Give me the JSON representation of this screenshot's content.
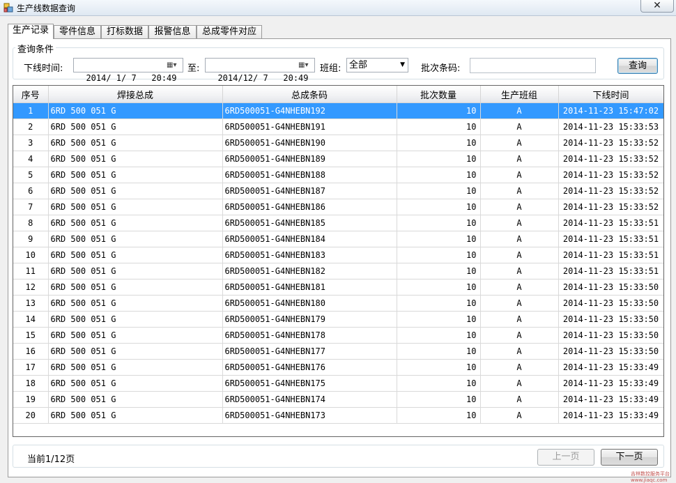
{
  "window": {
    "title": "生产线数据查询",
    "close_glyph": "✕"
  },
  "tabs": [
    "生产记录",
    "零件信息",
    "打标数据",
    "报警信息",
    "总成零件对应"
  ],
  "query": {
    "group_title": "查询条件",
    "time_label": "下线时间:",
    "start_time": "2014/ 1/ 7   20:49",
    "to_label": "至:",
    "end_time": "2014/12/ 7   20:49",
    "shift_label": "班组:",
    "shift_value": "全部",
    "batch_label": "批次条码:",
    "batch_value": "",
    "search_button": "查询"
  },
  "grid": {
    "columns": [
      "序号",
      "焊接总成",
      "总成条码",
      "批次数量",
      "生产班组",
      "下线时间"
    ],
    "rows": [
      [
        "1",
        "6RD 500 051 G",
        "6RD500051-G4NHEBN192",
        "10",
        "A",
        "2014-11-23 15:47:02"
      ],
      [
        "2",
        "6RD 500 051 G",
        "6RD500051-G4NHEBN191",
        "10",
        "A",
        "2014-11-23 15:33:53"
      ],
      [
        "3",
        "6RD 500 051 G",
        "6RD500051-G4NHEBN190",
        "10",
        "A",
        "2014-11-23 15:33:52"
      ],
      [
        "4",
        "6RD 500 051 G",
        "6RD500051-G4NHEBN189",
        "10",
        "A",
        "2014-11-23 15:33:52"
      ],
      [
        "5",
        "6RD 500 051 G",
        "6RD500051-G4NHEBN188",
        "10",
        "A",
        "2014-11-23 15:33:52"
      ],
      [
        "6",
        "6RD 500 051 G",
        "6RD500051-G4NHEBN187",
        "10",
        "A",
        "2014-11-23 15:33:52"
      ],
      [
        "7",
        "6RD 500 051 G",
        "6RD500051-G4NHEBN186",
        "10",
        "A",
        "2014-11-23 15:33:52"
      ],
      [
        "8",
        "6RD 500 051 G",
        "6RD500051-G4NHEBN185",
        "10",
        "A",
        "2014-11-23 15:33:51"
      ],
      [
        "9",
        "6RD 500 051 G",
        "6RD500051-G4NHEBN184",
        "10",
        "A",
        "2014-11-23 15:33:51"
      ],
      [
        "10",
        "6RD 500 051 G",
        "6RD500051-G4NHEBN183",
        "10",
        "A",
        "2014-11-23 15:33:51"
      ],
      [
        "11",
        "6RD 500 051 G",
        "6RD500051-G4NHEBN182",
        "10",
        "A",
        "2014-11-23 15:33:51"
      ],
      [
        "12",
        "6RD 500 051 G",
        "6RD500051-G4NHEBN181",
        "10",
        "A",
        "2014-11-23 15:33:50"
      ],
      [
        "13",
        "6RD 500 051 G",
        "6RD500051-G4NHEBN180",
        "10",
        "A",
        "2014-11-23 15:33:50"
      ],
      [
        "14",
        "6RD 500 051 G",
        "6RD500051-G4NHEBN179",
        "10",
        "A",
        "2014-11-23 15:33:50"
      ],
      [
        "15",
        "6RD 500 051 G",
        "6RD500051-G4NHEBN178",
        "10",
        "A",
        "2014-11-23 15:33:50"
      ],
      [
        "16",
        "6RD 500 051 G",
        "6RD500051-G4NHEBN177",
        "10",
        "A",
        "2014-11-23 15:33:50"
      ],
      [
        "17",
        "6RD 500 051 G",
        "6RD500051-G4NHEBN176",
        "10",
        "A",
        "2014-11-23 15:33:49"
      ],
      [
        "18",
        "6RD 500 051 G",
        "6RD500051-G4NHEBN175",
        "10",
        "A",
        "2014-11-23 15:33:49"
      ],
      [
        "19",
        "6RD 500 051 G",
        "6RD500051-G4NHEBN174",
        "10",
        "A",
        "2014-11-23 15:33:49"
      ],
      [
        "20",
        "6RD 500 051 G",
        "6RD500051-G4NHEBN173",
        "10",
        "A",
        "2014-11-23 15:33:49"
      ]
    ]
  },
  "pager": {
    "page_text": "当前1/12页",
    "prev_button": "上一页",
    "next_button": "下一页"
  },
  "watermark": "吉林数控服务平台 www.jiaqc.com"
}
